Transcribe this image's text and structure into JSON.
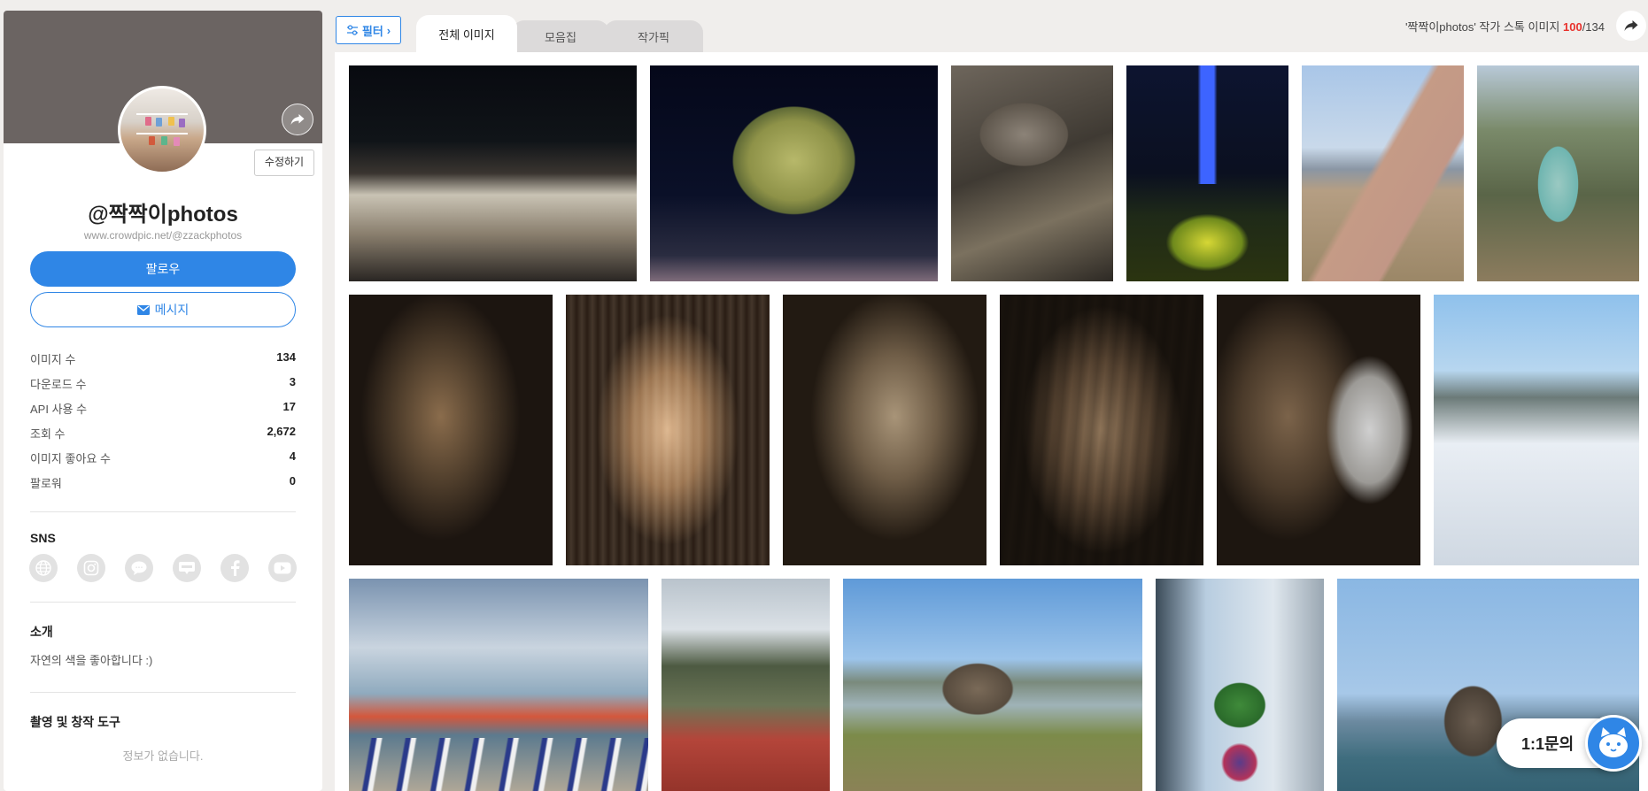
{
  "profile": {
    "username": "@짝짝이photos",
    "url": "www.crowdpic.net/@zzackphotos",
    "edit_label": "수정하기",
    "follow_label": "팔로우",
    "message_label": "메시지"
  },
  "stats": [
    {
      "label": "이미지 수",
      "value": "134"
    },
    {
      "label": "다운로드 수",
      "value": "3"
    },
    {
      "label": "API 사용 수",
      "value": "17"
    },
    {
      "label": "조회 수",
      "value": "2,672"
    },
    {
      "label": "이미지 좋아요 수",
      "value": "4"
    },
    {
      "label": "팔로워",
      "value": "0"
    }
  ],
  "sns": {
    "title": "SNS",
    "icons": [
      "globe-icon",
      "instagram-icon",
      "chat-bubble-icon",
      "blog-icon",
      "facebook-icon",
      "youtube-icon"
    ]
  },
  "intro": {
    "title": "소개",
    "text": "자연의 색을 좋아합니다 :)"
  },
  "tools": {
    "title": "촬영 및 창작 도구",
    "empty": "정보가 없습니다."
  },
  "toolbar": {
    "filter_label": "필터",
    "tabs": [
      {
        "label": "전체 이미지",
        "active": true
      },
      {
        "label": "모음집",
        "active": false
      },
      {
        "label": "작가픽",
        "active": false
      }
    ],
    "count_prefix": "'짝짝이photos' 작가 스톡 이미지 ",
    "count_shown": "100",
    "count_total": "/134"
  },
  "colors": {
    "accent": "#2f86e6",
    "highlight": "#e8322d",
    "cover": "#6b6462"
  },
  "photos": [
    "night-traditional-wall",
    "night-tree",
    "stone-rock-closeup",
    "blue-light-tower",
    "riverside-path",
    "rock-arch-cliff",
    "cave-wall",
    "cave-stalactites",
    "cave-formations",
    "cave-pillars",
    "cave-dome",
    "snowy-river-town",
    "beach-parasols",
    "mountain-red-roof",
    "river-rock-field",
    "window-plant",
    "lake-rocks"
  ],
  "chat": {
    "label": "1:1문의"
  }
}
